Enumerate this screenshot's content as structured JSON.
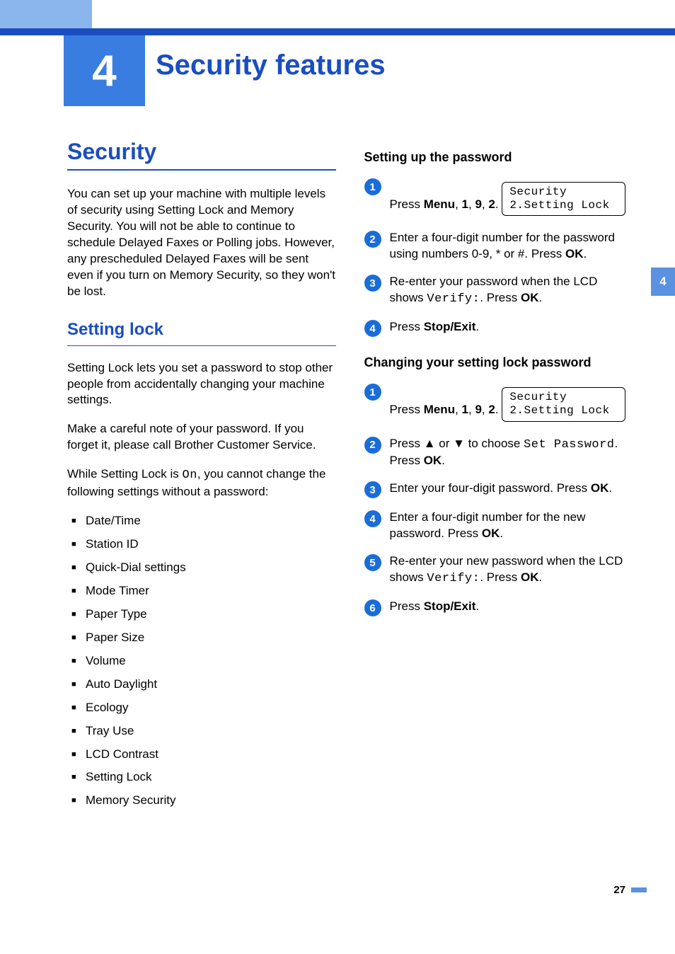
{
  "chapter": {
    "number": "4",
    "title": "Security features"
  },
  "side_tab": "4",
  "page_number": "27",
  "left": {
    "h1": "Security",
    "intro": "You can set up your machine with multiple levels of security using Setting Lock and Memory Security. You will not be able to continue to schedule Delayed Faxes or Polling jobs. However, any prescheduled Delayed Faxes will be sent even if you turn on Memory Security, so they won't be lost.",
    "h2": "Setting lock",
    "p1": "Setting Lock lets you set a password to stop other people from accidentally changing your machine settings.",
    "p2": "Make a careful note of your password. If you forget it, please call Brother Customer Service.",
    "p3_pre": "While Setting Lock is ",
    "p3_mono": "On",
    "p3_post": ", you cannot change the following settings without a password:",
    "bullets": [
      "Date/Time",
      "Station ID",
      "Quick-Dial settings",
      "Mode Timer",
      "Paper Type",
      "Paper Size",
      "Volume",
      "Auto Daylight",
      "Ecology",
      "Tray Use",
      "LCD Contrast",
      "Setting Lock",
      "Memory Security"
    ]
  },
  "right": {
    "sectionA": {
      "heading": "Setting up the password",
      "steps": {
        "s1": {
          "pre": "Press ",
          "b1": "Menu",
          "mid1": ", ",
          "b2": "1",
          "mid2": ", ",
          "b3": "9",
          "mid3": ", ",
          "b4": "2",
          "post": "."
        },
        "lcd1_l1": "Security",
        "lcd1_l2": "2.Setting Lock",
        "s2_pre": "Enter a four-digit number for the password using numbers 0-9, ",
        "s2_sym1": "*",
        "s2_mid": " or #. Press ",
        "s2_b": "OK",
        "s2_post": ".",
        "s3_pre": "Re-enter your password when the LCD shows ",
        "s3_mono": "Verify:",
        "s3_mid": ". Press ",
        "s3_b": "OK",
        "s3_post": ".",
        "s4_pre": "Press ",
        "s4_b": "Stop/Exit",
        "s4_post": "."
      }
    },
    "sectionB": {
      "heading": "Changing your setting lock password",
      "steps": {
        "s1": {
          "pre": "Press ",
          "b1": "Menu",
          "mid1": ", ",
          "b2": "1",
          "mid2": ", ",
          "b3": "9",
          "mid3": ", ",
          "b4": "2",
          "post": "."
        },
        "lcd1_l1": "Security",
        "lcd1_l2": "2.Setting Lock",
        "s2_pre": "Press ",
        "s2_up": "▲",
        "s2_mid1": " or ",
        "s2_dn": "▼",
        "s2_mid2": " to choose ",
        "s2_mono": "Set Password",
        "s2_mid3": ". Press ",
        "s2_b": "OK",
        "s2_post": ".",
        "s3_pre": "Enter your four-digit password. Press ",
        "s3_b": "OK",
        "s3_post": ".",
        "s4_pre": "Enter a four-digit number for the new password. Press ",
        "s4_b": "OK",
        "s4_post": ".",
        "s5_pre": "Re-enter your new password when the LCD shows ",
        "s5_mono": "Verify:",
        "s5_mid": ". Press ",
        "s5_b": "OK",
        "s5_post": ".",
        "s6_pre": "Press ",
        "s6_b": "Stop/Exit",
        "s6_post": "."
      }
    }
  }
}
